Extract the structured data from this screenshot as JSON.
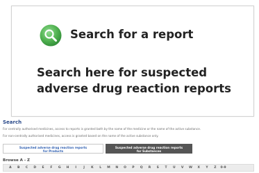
{
  "search_card": {
    "icon": "search-icon",
    "icon_color": "#4fb04f",
    "title": "Search for a report",
    "description": "Search here for suspected adverse drug reaction reports"
  },
  "lower_page": {
    "heading": "Search",
    "line1": "For centrally authorised medicines, access to reports is granted both by the name of the medicine or the name of the active substance.",
    "line2": "For non-centrally authorised medicines, access is granted based on the name of the active substance only.",
    "tabs": [
      {
        "line1": "Suspected adverse drug reaction reports",
        "line2": "for Products"
      },
      {
        "line1": "Suspected adverse drug reaction reports",
        "line2": "for Substances"
      }
    ],
    "browse_label": "Browse A - Z",
    "letters": [
      "A",
      "B",
      "C",
      "D",
      "E",
      "F",
      "G",
      "H",
      "I",
      "J",
      "K",
      "L",
      "M",
      "N",
      "O",
      "P",
      "Q",
      "R",
      "S",
      "T",
      "U",
      "V",
      "W",
      "X",
      "Y",
      "Z",
      "0-9"
    ]
  }
}
